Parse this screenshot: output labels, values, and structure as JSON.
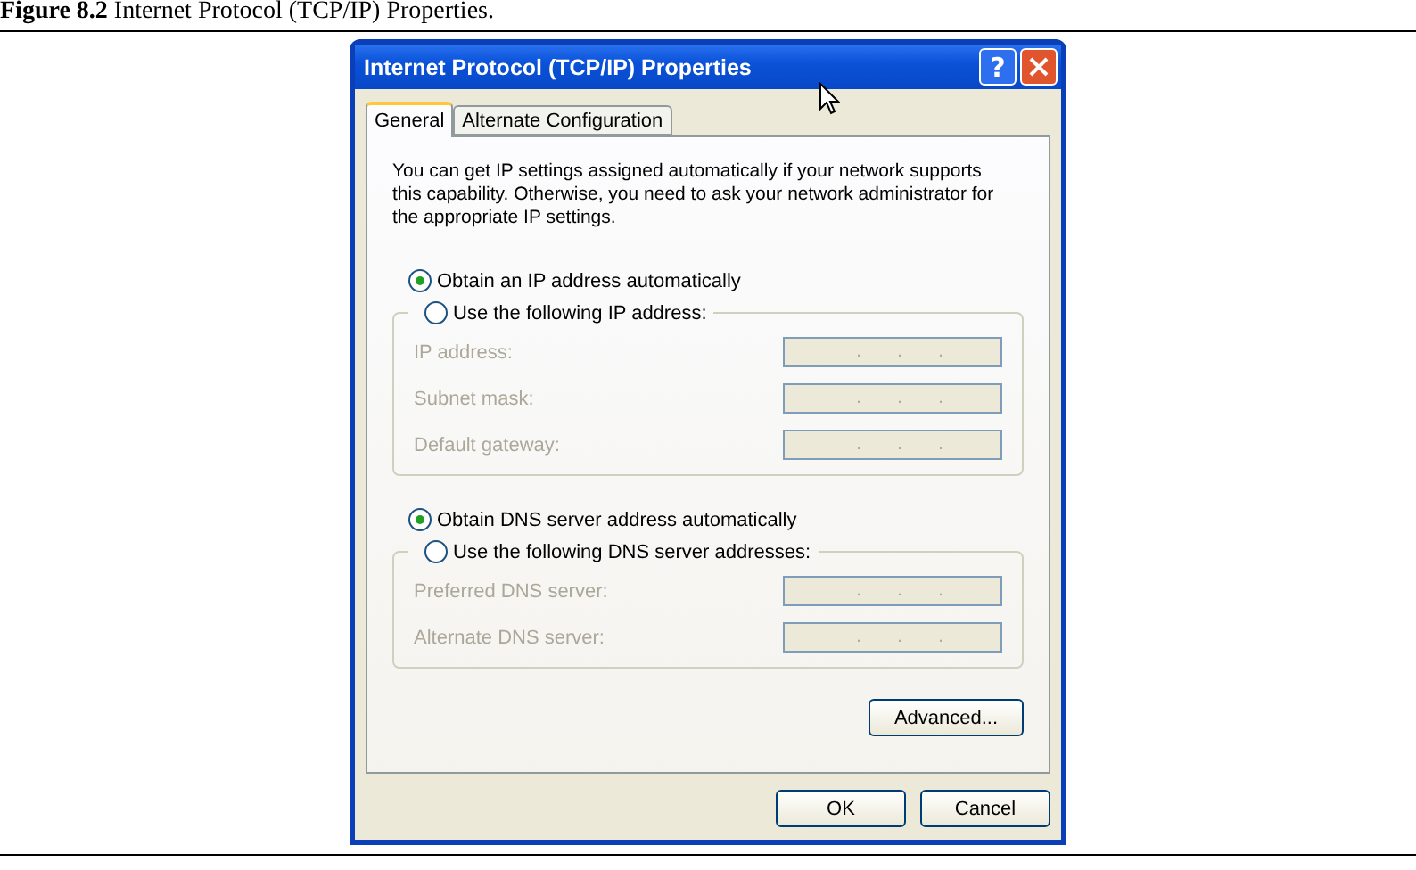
{
  "caption": {
    "text": "**Figure 8.2** Internet Protocol (TCP/IP) Properties."
  },
  "window": {
    "title": "Internet Protocol (TCP/IP) Properties",
    "help_button": "?"
  },
  "tabs": [
    {
      "label": "General",
      "selected": true
    },
    {
      "label": "Alternate Configuration",
      "selected": false
    }
  ],
  "description": "You can get IP settings assigned automatically if your network supports this capability. Otherwise, you need to ask your network administrator for the appropriate IP settings.",
  "options": [
    {
      "kind": "plain",
      "label": "Obtain an IP address automatically",
      "selected": true
    },
    {
      "kind": "group",
      "label": "Use the following IP address:",
      "selected": false,
      "fields": [
        {
          "label": "IP address:",
          "separators": [
            ".",
            ".",
            "."
          ],
          "disabled": true
        },
        {
          "label": "Subnet mask:",
          "separators": [
            ".",
            ".",
            "."
          ],
          "disabled": true
        },
        {
          "label": "Default gateway:",
          "separators": [
            ".",
            ".",
            "."
          ],
          "disabled": true
        }
      ]
    },
    {
      "kind": "plain",
      "label": "Obtain DNS server address automatically",
      "selected": true
    },
    {
      "kind": "group",
      "label": "Use the following DNS server addresses:",
      "selected": false,
      "fields": [
        {
          "label": "Preferred DNS server:",
          "separators": [
            ".",
            ".",
            "."
          ],
          "disabled": true
        },
        {
          "label": "Alternate DNS server:",
          "separators": [
            ".",
            ".",
            "."
          ],
          "disabled": true
        }
      ]
    }
  ],
  "advanced_button": "Advanced...",
  "buttons": [
    "OK",
    "Cancel"
  ]
}
